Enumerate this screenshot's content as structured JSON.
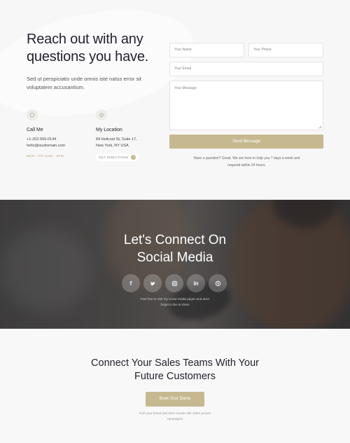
{
  "contact": {
    "headline": "Reach out with any questions you have.",
    "intro": "Sed ut perspiciatis unde omnis iste natus error sit voluptatem accusantium.",
    "call": {
      "title": "Call Me",
      "phone": "+1-202-555-0144",
      "email": "hello@ourdomain.com",
      "hours": "MON - FRI 8AM - 5PM"
    },
    "location": {
      "title": "My Location",
      "address_line1": "84 Hellcost St, Suite 17,",
      "address_line2": "New York, NY USA",
      "directions_label": "GET DIRECTIONS"
    },
    "form": {
      "name_placeholder": "Your Name",
      "phone_placeholder": "Your Phone",
      "email_placeholder": "Your Email",
      "message_placeholder": "Your Message",
      "submit_label": "Send Message",
      "note": "Have a question? Great. We are here to help you 7 days a week and respond within 24 hours."
    }
  },
  "social": {
    "heading": "Let's Connect On Social Media",
    "icons": [
      "facebook-icon",
      "twitter-icon",
      "instagram-icon",
      "linkedin-icon",
      "skype-icon"
    ],
    "subtext": "Feel free to visit my social media pages and don't forget to like & share"
  },
  "cta": {
    "heading": "Connect Your Sales Teams With Your Future Customers",
    "button_label": "Book Your Demo",
    "subtext": "Fuel your brand and drive results with 100% proven campaigns!"
  },
  "colors": {
    "accent": "#c6b88f",
    "heading": "#23232f",
    "background": "#f7f7f7"
  }
}
